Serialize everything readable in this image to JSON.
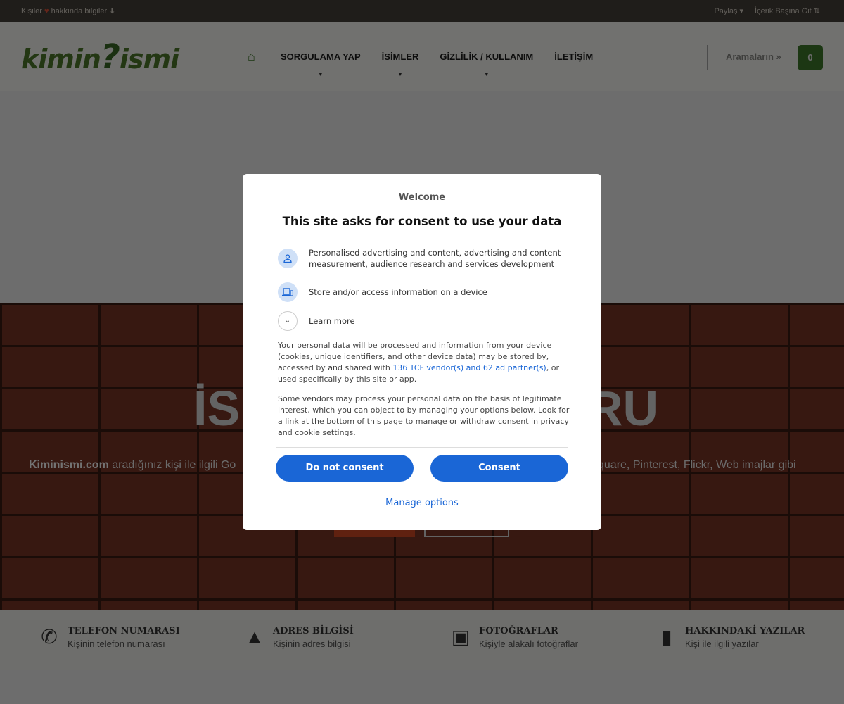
{
  "topbar": {
    "left_prefix": "Kişiler",
    "left_suffix": "hakkında bilgiler ⬇",
    "share": "Paylaş ▾",
    "go_top": "İçerik Başına Git ⇅"
  },
  "header": {
    "logo": "kimin?ismi",
    "logo_left": "kimin",
    "logo_q": "?",
    "logo_right": "ismi",
    "nav": [
      {
        "label": "SORGULAMA YAP"
      },
      {
        "label": "İSİMLER"
      },
      {
        "label": "GİZLİLİK / KULLANIM"
      },
      {
        "label": "İLETİŞİM"
      }
    ],
    "searches_label": "Aramaların  »",
    "searches_count": "0"
  },
  "hero": {
    "title_left": "İSİ",
    "title_right": "RU",
    "text_brand": "Kiminismi.com",
    "text_left": " aradığınız kişi ile ilgili Go",
    "text_right": "square, Pinterest, Flickr, Web imajlar gibi"
  },
  "features": [
    {
      "title": "TELEFON NUMARASI",
      "subtitle": "Kişinin telefon numarası",
      "icon": "phone-icon"
    },
    {
      "title": "ADRES BİLGİSİ",
      "subtitle": "Kişinin adres bilgisi",
      "icon": "road-icon"
    },
    {
      "title": "FOTOĞRAFLAR",
      "subtitle": "Kişiyle alakalı fotoğraflar",
      "icon": "image-icon"
    },
    {
      "title": "HAKKINDAKİ YAZILAR",
      "subtitle": "Kişi ile ilgili yazılar",
      "icon": "book-icon"
    }
  ],
  "consent": {
    "welcome": "Welcome",
    "title": "This site asks for consent to use your data",
    "purposes": [
      {
        "text": "Personalised advertising and content, advertising and content measurement, audience research and services development",
        "icon": "person-icon"
      },
      {
        "text": "Store and/or access information on a device",
        "icon": "devices-icon"
      }
    ],
    "learn_more": "Learn more",
    "para1_a": "Your personal data will be processed and information from your device (cookies, unique identifiers, and other device data) may be stored by, accessed by and shared with ",
    "para1_link": "136 TCF vendor(s) and 62 ad partner(s)",
    "para1_b": ", or used specifically by this site or app.",
    "para2": "Some vendors may process your personal data on the basis of legitimate interest, which you can object to by managing your options below. Look for a link at the bottom of this page to manage or withdraw consent in privacy and cookie settings.",
    "do_not_consent": "Do not consent",
    "consent": "Consent",
    "manage_options": "Manage options"
  },
  "colors": {
    "brand_green": "#3f7a2a",
    "consent_blue": "#1a66d6",
    "hero_button": "#d64a24"
  }
}
